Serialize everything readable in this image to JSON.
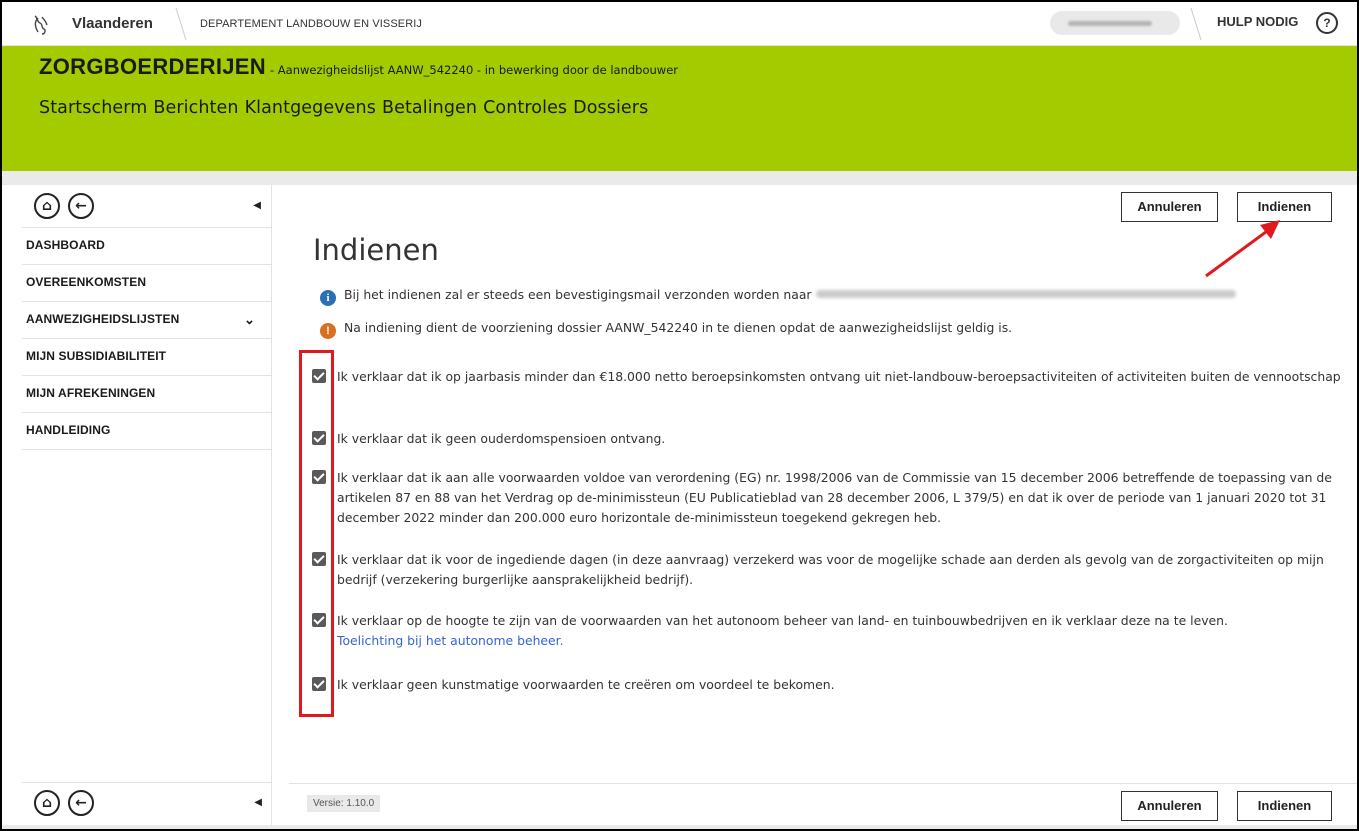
{
  "topbar": {
    "region": "Vlaanderen",
    "department": "DEPARTEMENT LANDBOUW EN VISSERIJ",
    "help_label": "HULP NODIG",
    "help_icon": "?"
  },
  "app": {
    "name": "ZORGBOERDERIJEN",
    "subtitle": "- Aanwezigheidslijst AANW_542240 - in bewerking door de landbouwer"
  },
  "mainnav": [
    "Startscherm",
    "Berichten",
    "Klantgegevens",
    "Betalingen",
    "Controles",
    "Dossiers"
  ],
  "sidebar": {
    "items": [
      {
        "label": "DASHBOARD"
      },
      {
        "label": "OVEREENKOMSTEN"
      },
      {
        "label": "AANWEZIGHEIDSLIJSTEN",
        "expandable": true
      },
      {
        "label": "MIJN SUBSIDIABILITEIT"
      },
      {
        "label": "MIJN AFREKENINGEN"
      },
      {
        "label": "HANDLEIDING"
      }
    ]
  },
  "toolbar": {
    "cancel_label": "Annuleren",
    "submit_label": "Indienen"
  },
  "page": {
    "title": "Indienen",
    "info_message": "Bij het indienen zal er steeds een bevestigingsmail verzonden worden naar",
    "warning_message": "Na indiening dient de voorziening dossier AANW_542240 in te dienen opdat de aanwezigheidslijst geldig is."
  },
  "declarations": [
    {
      "text": "Ik verklaar dat ik op jaarbasis minder dan €18.000 netto beroepsinkomsten ontvang uit niet-landbouw-beroepsactiviteiten of activiteiten buiten de vennootschap",
      "checked": true
    },
    {
      "text": "Ik verklaar dat ik geen ouderdomspensioen ontvang.",
      "checked": true
    },
    {
      "text": "Ik verklaar dat ik aan alle voorwaarden voldoe van verordening (EG) nr. 1998/2006 van de Commissie van 15 december 2006 betreffende de toepassing van de artikelen 87 en 88 van het Verdrag op de-minimissteun (EU Publicatieblad van 28 december 2006, L 379/5) en dat ik over de periode van 1 januari 2020 tot 31 december 2022 minder dan 200.000 euro horizontale de-minimissteun toegekend gekregen heb.",
      "checked": true
    },
    {
      "text": "Ik verklaar dat ik voor de ingediende dagen (in deze aanvraag) verzekerd was voor de mogelijke schade aan derden als gevolg van de zorgactiviteiten op mijn bedrijf (verzekering burgerlijke aansprakelijkheid bedrijf).",
      "checked": true
    },
    {
      "text": "Ik verklaar op de hoogte te zijn van de voorwaarden van het autonoom beheer van land- en tuinbouwbedrijven en ik verklaar deze na te leven.",
      "link": "Toelichting bij het autonome beheer.",
      "checked": true
    },
    {
      "text": "Ik verklaar geen kunstmatige voorwaarden te creëren om voordeel te bekomen.",
      "checked": true
    }
  ],
  "footer": {
    "version": "Versie: 1.10.0"
  },
  "colors": {
    "brand_green": "#a3cb00",
    "annotation_red": "#e0191e",
    "link_blue": "#3564d6"
  }
}
